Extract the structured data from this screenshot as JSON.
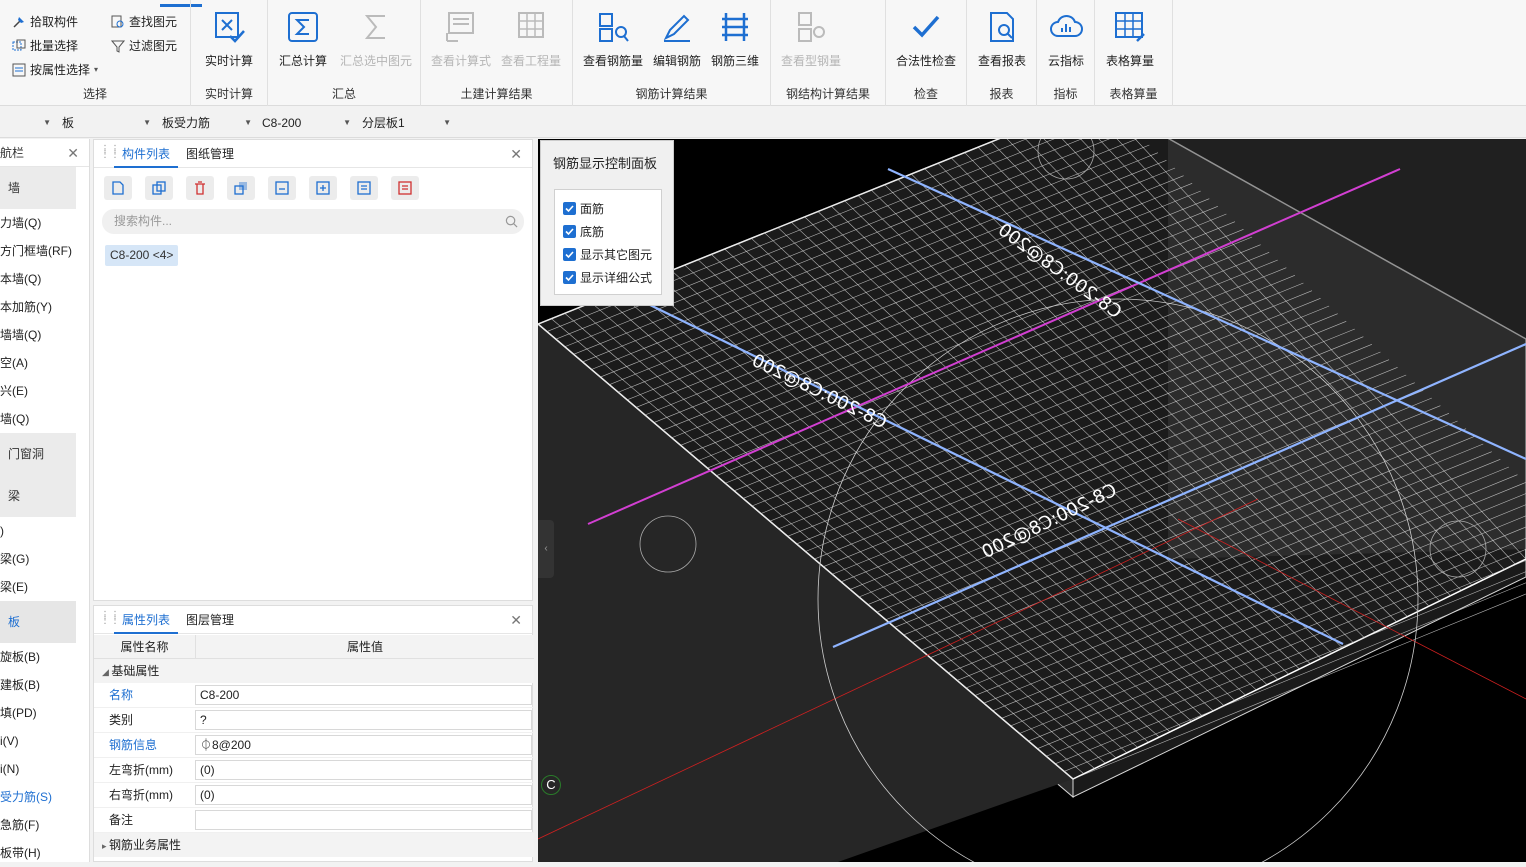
{
  "ribbon": {
    "select": {
      "group_label": "选择",
      "pick": "拾取构件",
      "batch": "批量选择",
      "by_attr": "按属性选择",
      "find": "查找图元",
      "filter": "过滤图元"
    },
    "groups": [
      {
        "label": "实时计算",
        "buttons": [
          {
            "label": "实时计算",
            "icon": "realtime-calc-icon",
            "enabled": true
          }
        ]
      },
      {
        "label": "汇总",
        "buttons": [
          {
            "label": "汇总计算",
            "icon": "sum-calc-icon",
            "enabled": true
          },
          {
            "label": "汇总选中图元",
            "icon": "sum-selected-icon",
            "enabled": false
          }
        ]
      },
      {
        "label": "土建计算结果",
        "buttons": [
          {
            "label": "查看计算式",
            "icon": "view-formula-icon",
            "enabled": false
          },
          {
            "label": "查看工程量",
            "icon": "view-quantity-icon",
            "enabled": false
          }
        ]
      },
      {
        "label": "钢筋计算结果",
        "buttons": [
          {
            "label": "查看钢筋量",
            "icon": "view-rebar-qty-icon",
            "enabled": true
          },
          {
            "label": "编辑钢筋",
            "icon": "edit-rebar-icon",
            "enabled": true
          },
          {
            "label": "钢筋三维",
            "icon": "rebar-3d-icon",
            "enabled": true
          }
        ]
      },
      {
        "label": "钢结构计算结果",
        "buttons": [
          {
            "label": "查看型钢量",
            "icon": "view-steel-icon",
            "enabled": false
          }
        ]
      },
      {
        "label": "检查",
        "buttons": [
          {
            "label": "合法性检查",
            "icon": "check-icon",
            "enabled": true
          }
        ]
      },
      {
        "label": "报表",
        "buttons": [
          {
            "label": "查看报表",
            "icon": "report-icon",
            "enabled": true
          }
        ]
      },
      {
        "label": "指标",
        "buttons": [
          {
            "label": "云指标",
            "icon": "cloud-index-icon",
            "enabled": true
          }
        ]
      },
      {
        "label": "表格算量",
        "buttons": [
          {
            "label": "表格算量",
            "icon": "table-calc-icon",
            "enabled": true
          }
        ]
      }
    ]
  },
  "filterbar": {
    "category": "板",
    "type": "板受力筋",
    "component": "C8-200",
    "layer": "分层板1"
  },
  "nav": {
    "title": "航栏",
    "items": [
      {
        "label": "墙",
        "kind": "cat"
      },
      {
        "label": "力墙(Q)",
        "kind": "item"
      },
      {
        "label": "方门框墙(RF)",
        "kind": "item"
      },
      {
        "label": "本墙(Q)",
        "kind": "item"
      },
      {
        "label": "本加筋(Y)",
        "kind": "item"
      },
      {
        "label": "墙墙(Q)",
        "kind": "item"
      },
      {
        "label": "空(A)",
        "kind": "item"
      },
      {
        "label": "兴(E)",
        "kind": "item"
      },
      {
        "label": "墙(Q)",
        "kind": "item"
      },
      {
        "label": "门窗洞",
        "kind": "cat"
      },
      {
        "label": "梁",
        "kind": "cat"
      },
      {
        "label": ")",
        "kind": "item"
      },
      {
        "label": "梁(G)",
        "kind": "item"
      },
      {
        "label": "梁(E)",
        "kind": "item"
      },
      {
        "label": "板",
        "kind": "cat",
        "selected": true
      },
      {
        "label": "旋板(B)",
        "kind": "item"
      },
      {
        "label": "建板(B)",
        "kind": "item"
      },
      {
        "label": "填(PD)",
        "kind": "item"
      },
      {
        "label": "i(V)",
        "kind": "item"
      },
      {
        "label": "i(N)",
        "kind": "item"
      },
      {
        "label": "受力筋(S)",
        "kind": "item",
        "selected": true
      },
      {
        "label": "急筋(F)",
        "kind": "item"
      },
      {
        "label": "板带(H)",
        "kind": "item"
      }
    ]
  },
  "complist": {
    "tabs": [
      "构件列表",
      "图纸管理"
    ],
    "search_placeholder": "搜索构件...",
    "chip": "C8-200 <4>"
  },
  "props": {
    "tabs": [
      "属性列表",
      "图层管理"
    ],
    "col_name": "属性名称",
    "col_value": "属性值",
    "section_basic": "基础属性",
    "rows": [
      {
        "name": "名称",
        "value": "C8-200",
        "blue": true
      },
      {
        "name": "类别",
        "value": "?",
        "blue": false
      },
      {
        "name": "钢筋信息",
        "value": "⏀8@200",
        "blue": true
      },
      {
        "name": "左弯折(mm)",
        "value": "(0)",
        "blue": false
      },
      {
        "name": "右弯折(mm)",
        "value": "(0)",
        "blue": false
      },
      {
        "name": "备注",
        "value": "",
        "blue": false
      }
    ],
    "section_rebar": "钢筋业务属性"
  },
  "control_panel": {
    "title": "钢筋显示控制面板",
    "options": [
      {
        "label": "面筋",
        "checked": true
      },
      {
        "label": "底筋",
        "checked": true
      },
      {
        "label": "显示其它图元",
        "checked": true
      },
      {
        "label": "显示详细公式",
        "checked": true
      }
    ]
  },
  "viewport": {
    "labels": [
      "C8-200:C8@200",
      "C8-200:C8@200",
      "C8-200:C8@200"
    ],
    "axis_badge": "C",
    "colors": {
      "grid": "#d8d8d8",
      "blue_bar": "#8fb4ff",
      "magenta_bar": "#d23fd2",
      "axis_red": "#d02020"
    }
  }
}
